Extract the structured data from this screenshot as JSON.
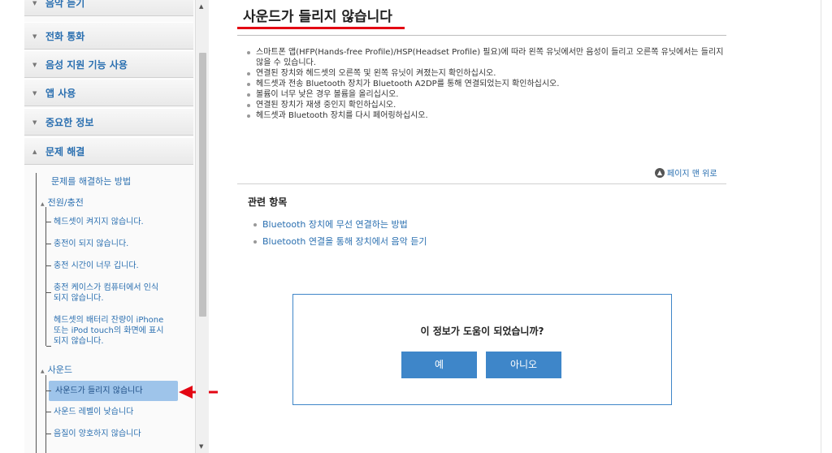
{
  "sidebar": {
    "categories": [
      {
        "label": "음악 듣기"
      },
      {
        "label": "전화 통화"
      },
      {
        "label": "음성 지원 기능 사용"
      },
      {
        "label": "앱 사용"
      },
      {
        "label": "중요한 정보"
      },
      {
        "label": "문제 해결"
      }
    ],
    "troubleshoot_intro": "문제를 해결하는 방법",
    "power_group": {
      "label": "전원/충전",
      "items": [
        "헤드셋이 켜지지 않습니다.",
        "충전이 되지 않습니다.",
        "충전 시간이 너무 깁니다.",
        "충전 케이스가 컴퓨터에서 인식\n되지 않습니다.",
        "헤드셋의 배터리 잔량이 iPhone\n또는 iPod touch의 화면에 표시\n되지 않습니다."
      ]
    },
    "sound_group": {
      "label": "사운드",
      "items": [
        "사운드가 들리지 않습니다",
        "사운드 레벨이 낮습니다",
        "음질이 양호하지 않습니다"
      ]
    }
  },
  "main": {
    "title": "사운드가 들리지 않습니다",
    "bullets": [
      "스마트폰 앱(HFP(Hands-free Profile)/HSP(Headset Profile) 필요)에 따라 왼쪽 유닛에서만 음성이 들리고 오른쪽 유닛에서는 들리지 않을 수 있습니다.",
      "연결된 장치와 헤드셋의 오른쪽 및 왼쪽 유닛이 켜졌는지 확인하십시오.",
      "헤드셋과 전송 Bluetooth 장치가 Bluetooth A2DP를 통해 연결되었는지 확인하십시오.",
      "볼륨이 너무 낮은 경우 볼륨을 올리십시오.",
      "연결된 장치가 재생 중인지 확인하십시오.",
      "헤드셋과 Bluetooth 장치를 다시 페어링하십시오."
    ],
    "back_to_top": "페이지 맨 위로",
    "related_title": "관련 항목",
    "related_links": [
      "Bluetooth 장치에 무선 연결하는 방법",
      "Bluetooth 연결을 통해 장치에서 음악 듣기"
    ],
    "feedback": {
      "question": "이 정보가 도움이 되었습니까?",
      "yes": "예",
      "no": "아니오"
    }
  },
  "colors": {
    "link": "#2a6fb0",
    "accent_red": "#e30613",
    "button_blue": "#3e86c9",
    "active_highlight": "#9ec4ea"
  }
}
